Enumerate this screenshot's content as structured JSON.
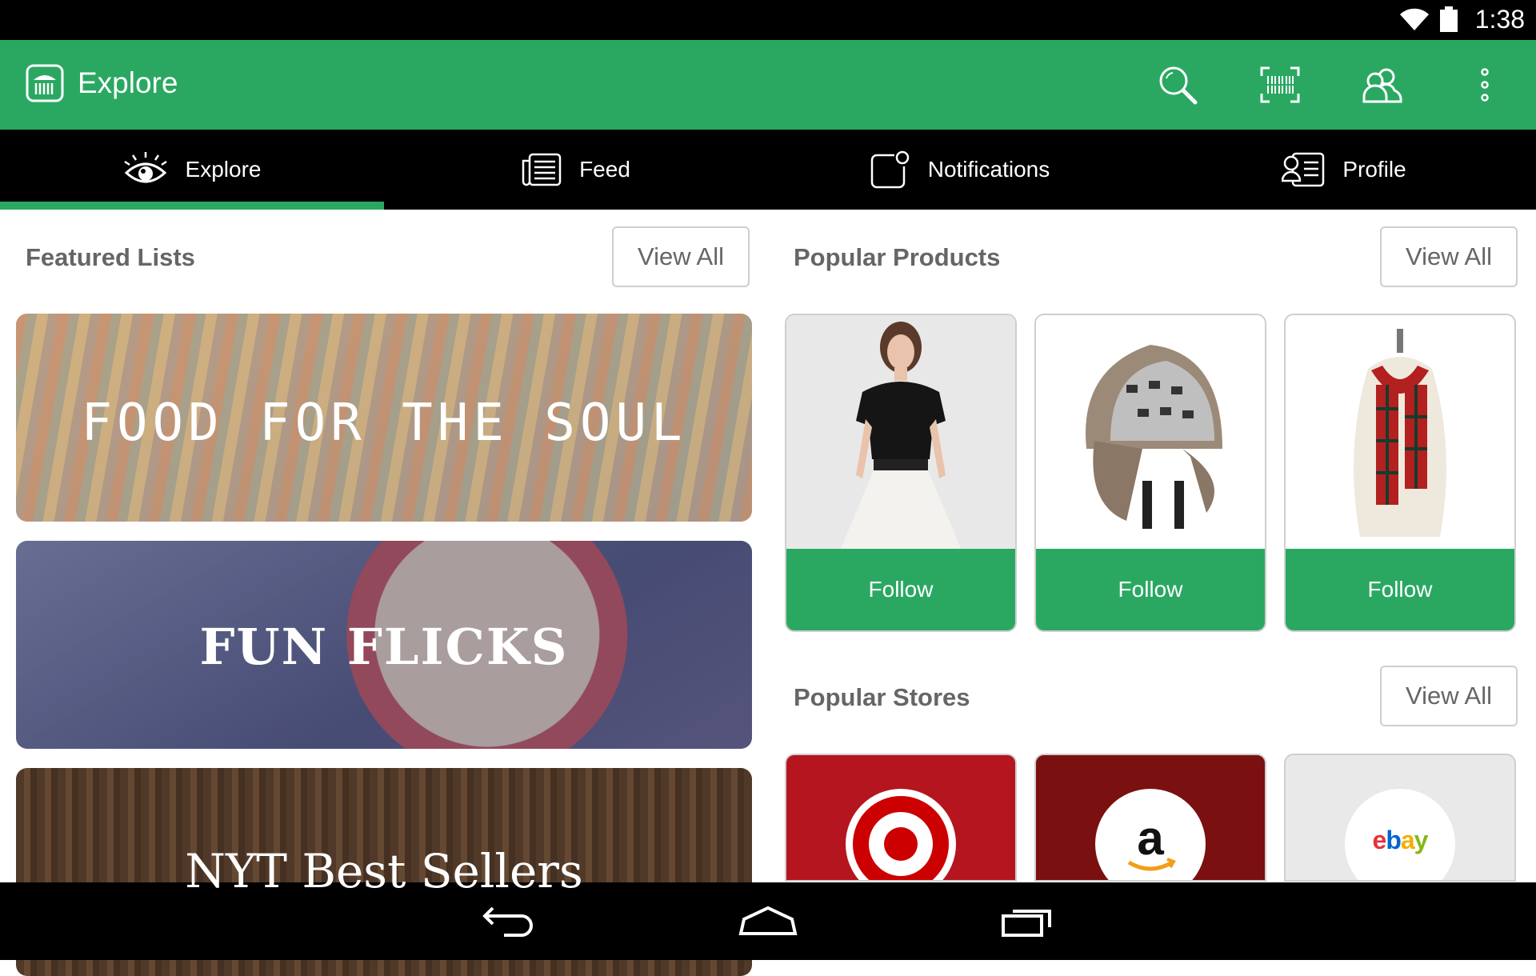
{
  "status_bar": {
    "time": "1:38",
    "wifi_icon": "wifi-icon",
    "battery_icon": "battery-icon"
  },
  "action_bar": {
    "title": "Explore",
    "color": "#2aa862",
    "actions": [
      "search-icon",
      "barcode-scan-icon",
      "friends-icon",
      "overflow-menu-icon"
    ]
  },
  "tabs": [
    {
      "label": "Explore",
      "icon": "eye-icon",
      "active": true
    },
    {
      "label": "Feed",
      "icon": "feed-icon",
      "active": false
    },
    {
      "label": "Notifications",
      "icon": "notifications-icon",
      "active": false
    },
    {
      "label": "Profile",
      "icon": "profile-icon",
      "active": false
    }
  ],
  "featured_lists": {
    "title": "Featured Lists",
    "view_all": "View All",
    "items": [
      {
        "text": "FOOD FOR THE SOUL"
      },
      {
        "text": "FUN FLICKS"
      },
      {
        "text": "NYT Best Sellers"
      }
    ]
  },
  "popular_products": {
    "title": "Popular Products",
    "view_all": "View All",
    "items": [
      {
        "image": "dress-image",
        "follow": "Follow"
      },
      {
        "image": "trapper-hat-image",
        "follow": "Follow"
      },
      {
        "image": "plaid-scarf-image",
        "follow": "Follow"
      }
    ]
  },
  "popular_stores": {
    "title": "Popular Stores",
    "view_all": "View All",
    "items": [
      {
        "logo": "target-logo"
      },
      {
        "logo": "amazon-logo"
      },
      {
        "logo": "ebay-logo",
        "text": "ebay"
      }
    ]
  },
  "nav_bar": [
    "back-icon",
    "home-icon",
    "recents-icon"
  ]
}
